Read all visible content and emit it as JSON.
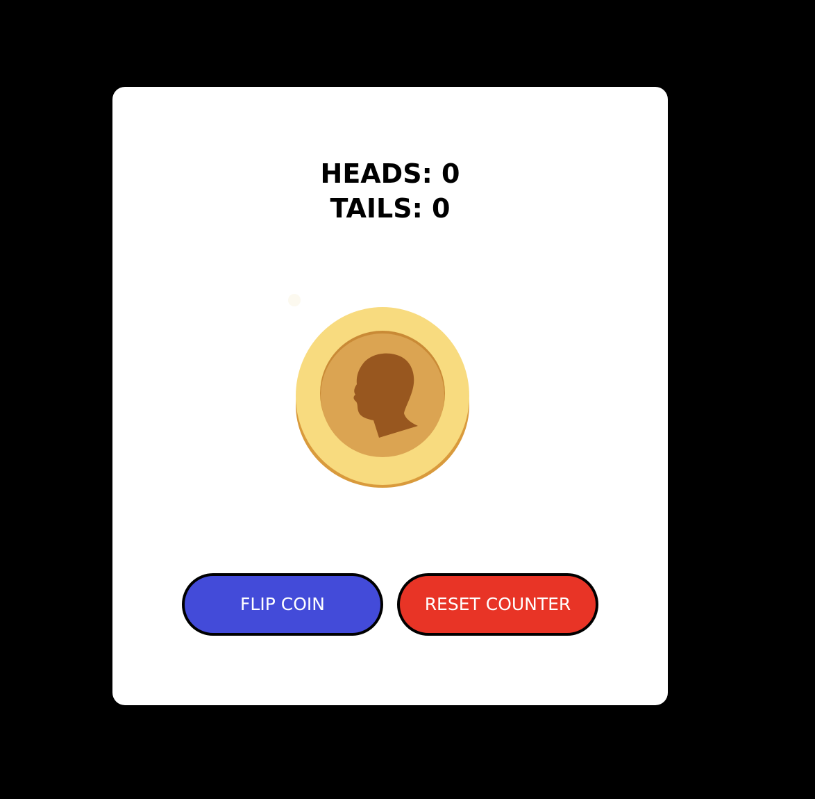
{
  "counter": {
    "heads_label": "HEADS: 0",
    "tails_label": "TAILS: 0",
    "heads": 0,
    "tails": 0
  },
  "coin": {
    "icon": "coin-heads-icon",
    "face": "heads"
  },
  "buttons": {
    "flip_label": "FLIP COIN",
    "reset_label": "RESET COUNTER"
  },
  "colors": {
    "background": "#000000",
    "card": "#ffffff",
    "flip_button": "#434bd9",
    "reset_button": "#e83426",
    "coin_rim": "#f8db7f",
    "coin_edge": "#d99a3c",
    "coin_face": "#dba452",
    "coin_silhouette": "#98571f"
  }
}
